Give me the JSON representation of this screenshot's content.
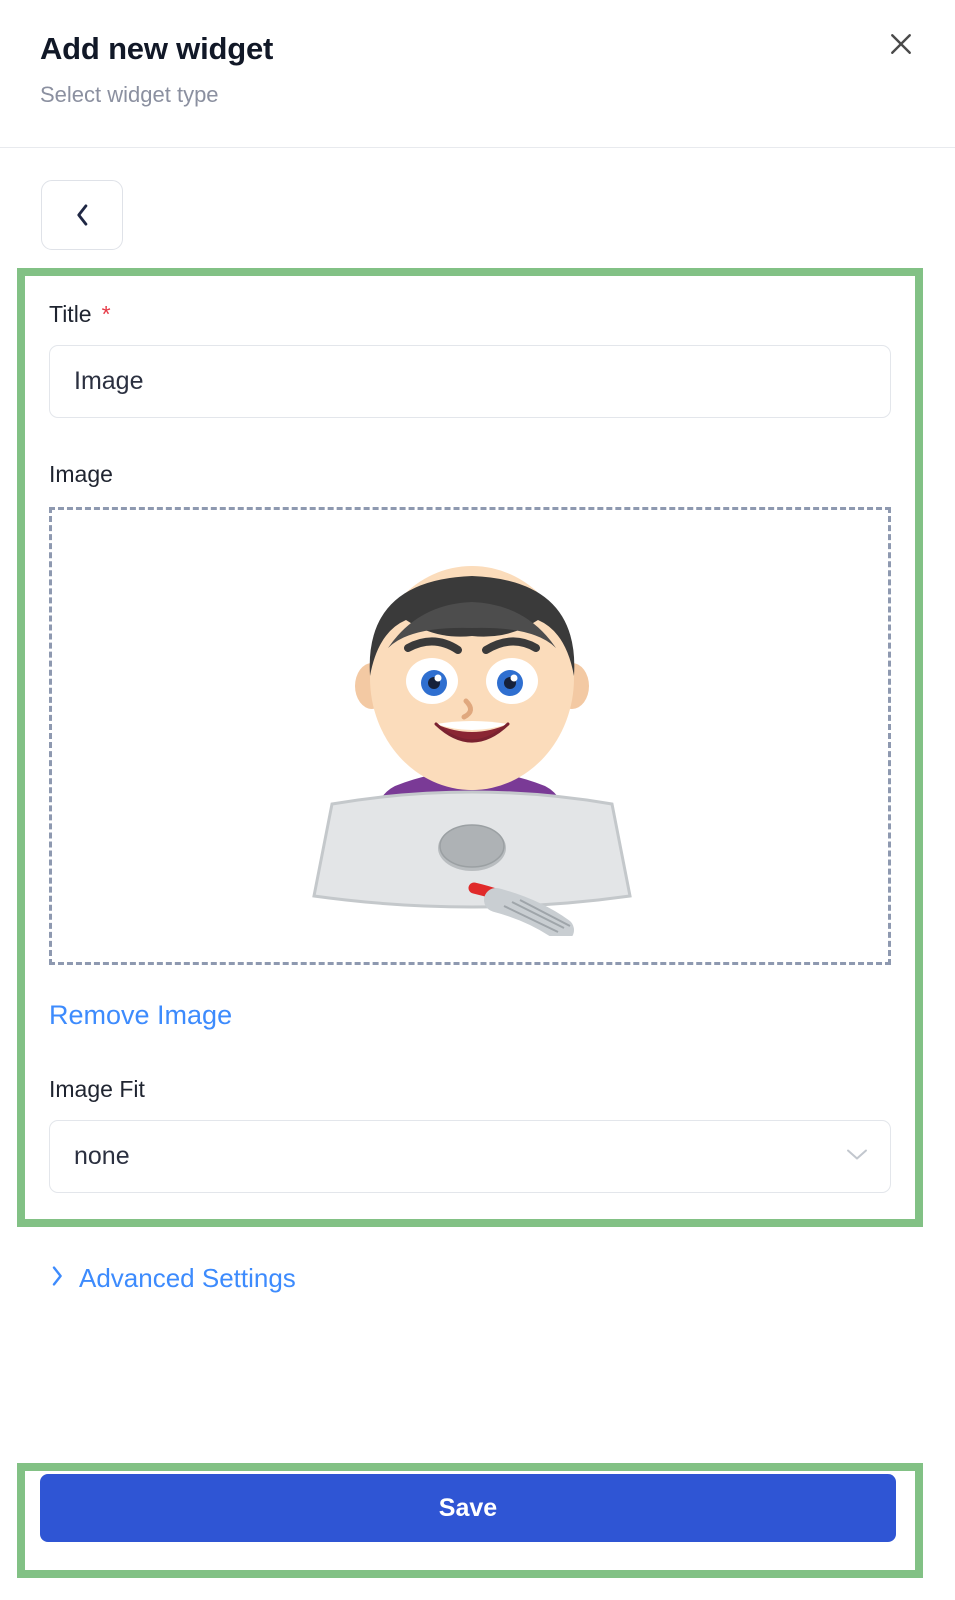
{
  "header": {
    "title": "Add new widget",
    "subtitle": "Select widget type",
    "close_icon": "close-icon"
  },
  "nav": {
    "back_icon": "chevron-left-icon"
  },
  "form": {
    "title_field": {
      "label": "Title",
      "required_marker": "*",
      "value": "Image",
      "placeholder": "Title"
    },
    "image_field": {
      "label": "Image",
      "dropzone_name": "image-dropzone",
      "remove_link": "Remove Image"
    },
    "image_fit_field": {
      "label": "Image Fit",
      "value": "none",
      "chevron_icon": "chevron-down-icon",
      "options": [
        "none"
      ]
    }
  },
  "advanced": {
    "label": "Advanced Settings",
    "chevron_icon": "chevron-right-icon"
  },
  "footer": {
    "save_label": "Save"
  },
  "colors": {
    "highlight_green": "#82c185",
    "primary_blue": "#2f55d4",
    "link_blue": "#3d8bfd",
    "required_red": "#e63946",
    "dropzone_dash": "#8e99b0"
  },
  "illustration": {
    "description": "Cartoon boy with black hair in purple shirt using a laptop at a brown desk",
    "hair": "#3a3a3a",
    "skin": "#f7d7b5",
    "shirt": "#7a3a96",
    "laptop": "#d9dde0",
    "desk": "#8a4a22",
    "eye": "#2f6fd0"
  }
}
